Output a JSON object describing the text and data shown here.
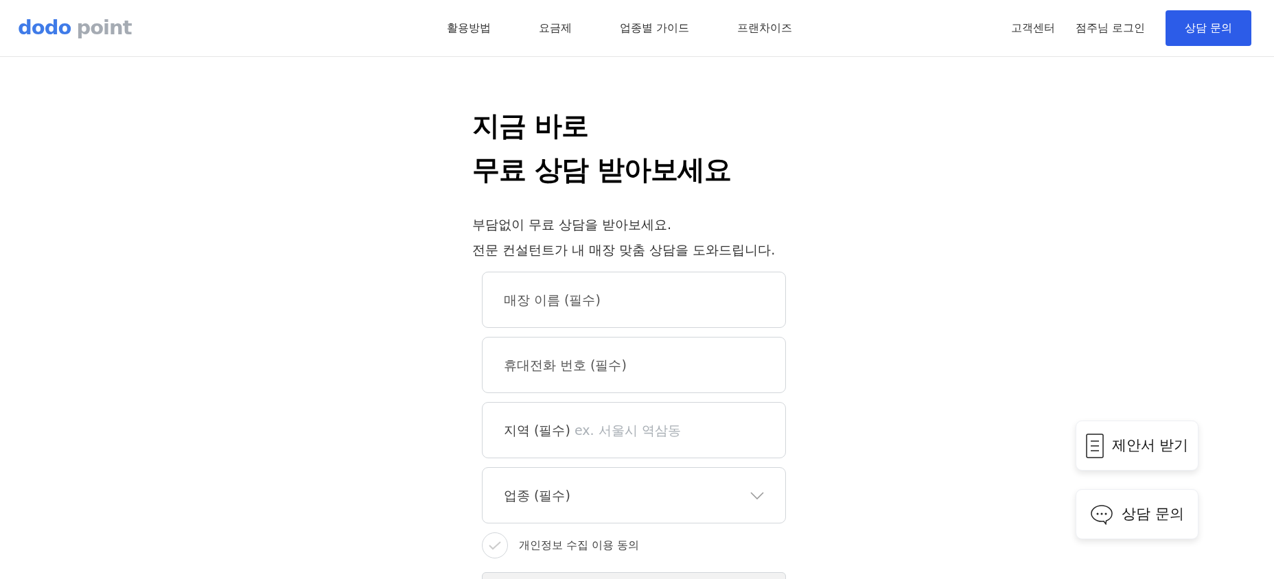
{
  "header": {
    "logo": {
      "brand": "dodo",
      "suffix": "point"
    },
    "nav": [
      "활용방법",
      "요금제",
      "업종별 가이드",
      "프랜차이즈"
    ],
    "links": [
      "고객센터",
      "점주님 로그인"
    ],
    "cta": "상담 문의"
  },
  "hero": {
    "title_lines": [
      "지금 바로",
      "무료 상담 받아보세요"
    ],
    "subtitle_lines": [
      "부담없이 무료 상담을 받아보세요.",
      "전문 컨설턴트가 내 매장 맞춤 상담을 도와드립니다."
    ]
  },
  "form": {
    "fields": [
      {
        "kind": "text",
        "placeholder": "매장 이름 (필수)"
      },
      {
        "kind": "text",
        "placeholder": "휴대전화 번호 (필수)"
      },
      {
        "kind": "labeled",
        "label": "지역 (필수)",
        "placeholder": "ex. 서울시 역삼동"
      },
      {
        "kind": "select",
        "placeholder": "업종 (필수)"
      }
    ],
    "consent": {
      "label": "개인정보 수집 이용 동의",
      "checked": false
    },
    "submit": {
      "disabled": true
    }
  },
  "floating_buttons": [
    {
      "kind": "document",
      "label": "제안서 받기"
    },
    {
      "kind": "chat",
      "label": "상담 문의"
    }
  ]
}
